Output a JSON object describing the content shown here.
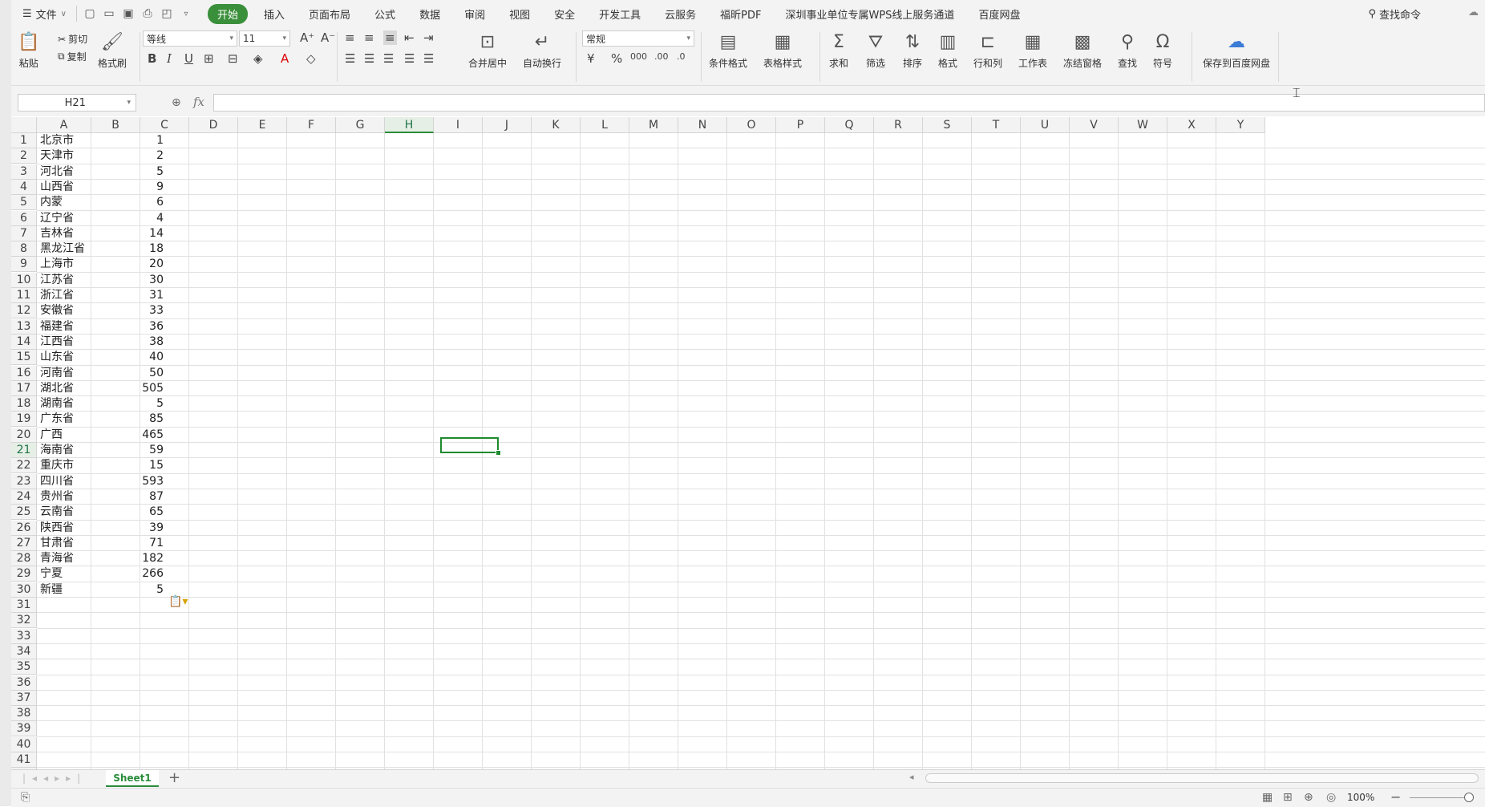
{
  "menu": {
    "file_label": "文件",
    "tabs": [
      "开始",
      "插入",
      "页面布局",
      "公式",
      "数据",
      "审阅",
      "视图",
      "安全",
      "开发工具",
      "云服务",
      "福昕PDF",
      "深圳事业单位专属WPS线上服务通道",
      "百度网盘"
    ],
    "active_tab": "开始",
    "search_label": "查找命令"
  },
  "ribbon": {
    "paste": "粘贴",
    "cut": "剪切",
    "copy": "复制",
    "format_painter": "格式刷",
    "font_name": "等线",
    "font_size": "11",
    "merge_center": "合并居中",
    "wrap_text": "自动换行",
    "number_format": "常规",
    "conditional_format": "条件格式",
    "table_style": "表格样式",
    "sum": "求和",
    "filter": "筛选",
    "sort": "排序",
    "format": "格式",
    "rows_cols": "行和列",
    "worksheet": "工作表",
    "freeze": "冻结窗格",
    "find": "查找",
    "symbol": "符号",
    "save_baidu": "保存到百度网盘"
  },
  "formula_bar": {
    "name_box": "H21",
    "fx": "fx",
    "formula": ""
  },
  "columns": [
    "A",
    "B",
    "C",
    "D",
    "E",
    "F",
    "G",
    "H",
    "I",
    "J",
    "K",
    "L",
    "M",
    "N",
    "O",
    "P",
    "Q",
    "R",
    "S",
    "T",
    "U",
    "V",
    "W",
    "X",
    "Y"
  ],
  "selected_cell": "H21",
  "data_rows": [
    {
      "name": "北京市",
      "value": "1"
    },
    {
      "name": "天津市",
      "value": "2"
    },
    {
      "name": "河北省",
      "value": "5"
    },
    {
      "name": "山西省",
      "value": "9"
    },
    {
      "name": "内蒙",
      "value": "6"
    },
    {
      "name": "辽宁省",
      "value": "4"
    },
    {
      "name": "吉林省",
      "value": "14"
    },
    {
      "name": "黑龙江省",
      "value": "18"
    },
    {
      "name": "上海市",
      "value": "20"
    },
    {
      "name": "江苏省",
      "value": "30"
    },
    {
      "name": "浙江省",
      "value": "31"
    },
    {
      "name": "安徽省",
      "value": "33"
    },
    {
      "name": "福建省",
      "value": "36"
    },
    {
      "name": "江西省",
      "value": "38"
    },
    {
      "name": "山东省",
      "value": "40"
    },
    {
      "name": "河南省",
      "value": "50"
    },
    {
      "name": "湖北省",
      "value": "505"
    },
    {
      "name": "湖南省",
      "value": "5"
    },
    {
      "name": "广东省",
      "value": "85"
    },
    {
      "name": "广西",
      "value": "465"
    },
    {
      "name": "海南省",
      "value": "59"
    },
    {
      "name": "重庆市",
      "value": "15"
    },
    {
      "name": "四川省",
      "value": "593"
    },
    {
      "name": "贵州省",
      "value": "87"
    },
    {
      "name": "云南省",
      "value": "65"
    },
    {
      "name": "陕西省",
      "value": "39"
    },
    {
      "name": "甘肃省",
      "value": "71"
    },
    {
      "name": "青海省",
      "value": "182"
    },
    {
      "name": "宁夏",
      "value": "266"
    },
    {
      "name": "新疆",
      "value": "5"
    }
  ],
  "sheet_tabs": [
    "Sheet1"
  ],
  "status": {
    "zoom": "100%"
  }
}
